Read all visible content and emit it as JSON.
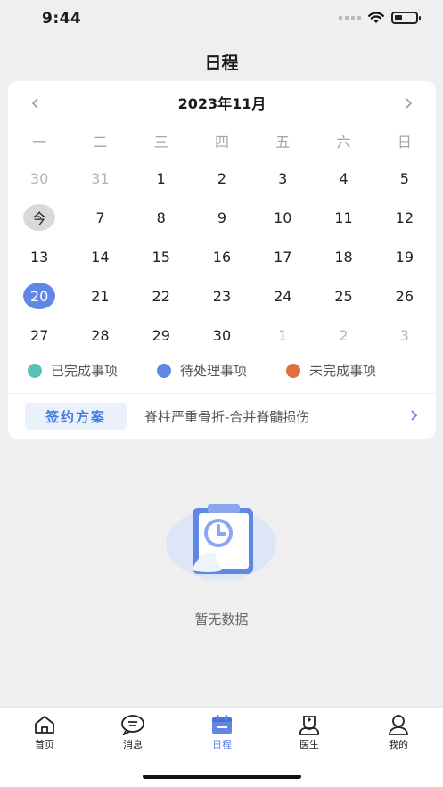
{
  "status_bar": {
    "time": "9:44",
    "battery_level": 0.35
  },
  "header": {
    "title": "日程"
  },
  "calendar": {
    "month_label": "2023年11月",
    "prev_icon": "chevron-left-icon",
    "next_icon": "chevron-right-icon",
    "weekdays": [
      "一",
      "二",
      "三",
      "四",
      "五",
      "六",
      "日"
    ],
    "weeks": [
      [
        {
          "label": "30",
          "state": "other"
        },
        {
          "label": "31",
          "state": "other"
        },
        {
          "label": "1",
          "state": "normal"
        },
        {
          "label": "2",
          "state": "normal"
        },
        {
          "label": "3",
          "state": "normal"
        },
        {
          "label": "4",
          "state": "normal"
        },
        {
          "label": "5",
          "state": "normal"
        }
      ],
      [
        {
          "label": "今",
          "state": "today"
        },
        {
          "label": "7",
          "state": "normal"
        },
        {
          "label": "8",
          "state": "normal"
        },
        {
          "label": "9",
          "state": "normal"
        },
        {
          "label": "10",
          "state": "normal"
        },
        {
          "label": "11",
          "state": "normal"
        },
        {
          "label": "12",
          "state": "normal"
        }
      ],
      [
        {
          "label": "13",
          "state": "normal"
        },
        {
          "label": "14",
          "state": "normal"
        },
        {
          "label": "15",
          "state": "normal"
        },
        {
          "label": "16",
          "state": "normal"
        },
        {
          "label": "17",
          "state": "normal"
        },
        {
          "label": "18",
          "state": "normal"
        },
        {
          "label": "19",
          "state": "normal"
        }
      ],
      [
        {
          "label": "20",
          "state": "selected"
        },
        {
          "label": "21",
          "state": "normal"
        },
        {
          "label": "22",
          "state": "normal"
        },
        {
          "label": "23",
          "state": "normal"
        },
        {
          "label": "24",
          "state": "normal"
        },
        {
          "label": "25",
          "state": "normal"
        },
        {
          "label": "26",
          "state": "normal"
        }
      ],
      [
        {
          "label": "27",
          "state": "normal"
        },
        {
          "label": "28",
          "state": "normal"
        },
        {
          "label": "29",
          "state": "normal"
        },
        {
          "label": "30",
          "state": "normal"
        },
        {
          "label": "1",
          "state": "other"
        },
        {
          "label": "2",
          "state": "other"
        },
        {
          "label": "3",
          "state": "other"
        }
      ]
    ]
  },
  "legend": [
    {
      "label": "已完成事项",
      "color": "#5bbfb5"
    },
    {
      "label": "待处理事项",
      "color": "#5f87e6"
    },
    {
      "label": "未完成事项",
      "color": "#e06f45"
    }
  ],
  "plan": {
    "tag": "签约方案",
    "text": "脊柱严重骨折-合并脊髓损伤",
    "arrow_icon": "chevron-right-icon"
  },
  "empty_state": {
    "text": "暂无数据",
    "icon": "clipboard-clock-icon"
  },
  "tabbar": {
    "items": [
      {
        "label": "首页",
        "icon": "home-icon",
        "active": false
      },
      {
        "label": "消息",
        "icon": "message-icon",
        "active": false
      },
      {
        "label": "日程",
        "icon": "calendar-icon",
        "active": true
      },
      {
        "label": "医生",
        "icon": "doctor-icon",
        "active": false
      },
      {
        "label": "我的",
        "icon": "user-icon",
        "active": false
      }
    ]
  },
  "colors": {
    "accent": "#5f87e6",
    "tag_bg": "#eaf1fb",
    "tag_text": "#3d7be0"
  }
}
